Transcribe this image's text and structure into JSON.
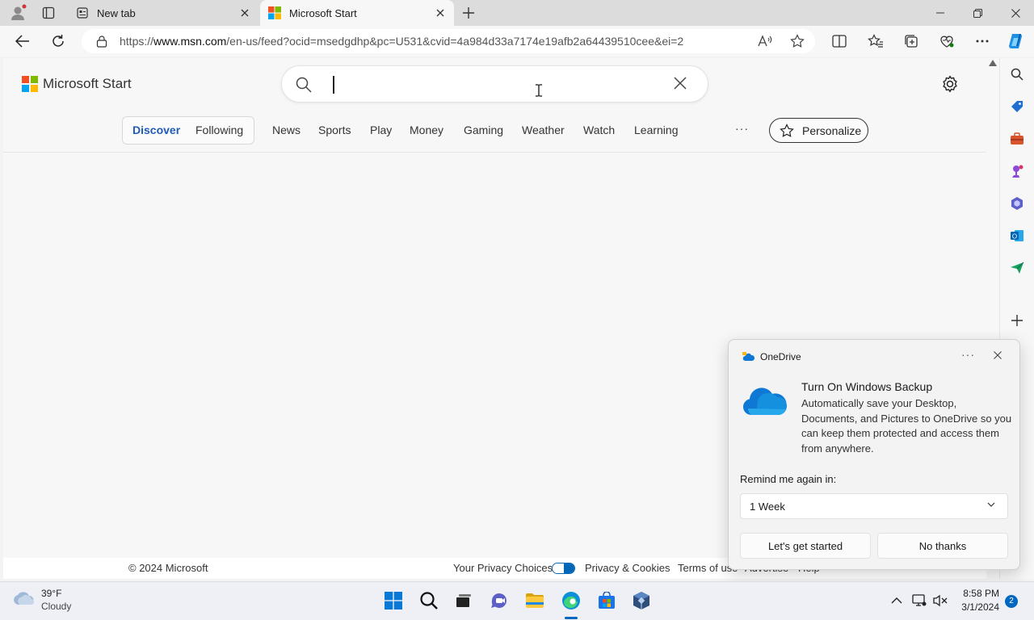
{
  "browser": {
    "tabs": [
      {
        "label": "New tab"
      },
      {
        "label": "Microsoft Start"
      }
    ],
    "url_prefix": "https://",
    "url_domain": "www.msn.com",
    "url_rest": "/en-us/feed?ocid=msedgdhp&pc=U531&cvid=4a984d33a7174e19afb2a64439510cee&ei=2"
  },
  "page": {
    "brand": "Microsoft Start",
    "search_placeholder": "",
    "feed_tabs": [
      "Discover",
      "Following"
    ],
    "categories": [
      "News",
      "Sports",
      "Play",
      "Money",
      "Gaming",
      "Weather",
      "Watch",
      "Learning"
    ],
    "more": "···",
    "personalize": "Personalize"
  },
  "footer": {
    "copyright": "© 2024 Microsoft",
    "privacy_choices": "Your Privacy Choices",
    "privacy_cookies": "Privacy & Cookies",
    "terms": "Terms of use",
    "advertise": "Advertise",
    "help": "Help"
  },
  "toast": {
    "app": "OneDrive",
    "more": "···",
    "title": "Turn On Windows Backup",
    "body": "Automatically save your Desktop, Documents, and Pictures to OneDrive so you can keep them protected and access them from anywhere.",
    "remind_label": "Remind me again in:",
    "remind_value": "1 Week",
    "primary_button": "Let's get started",
    "secondary_button": "No thanks"
  },
  "taskbar": {
    "weather_temp": "39°F",
    "weather_cond": "Cloudy",
    "time": "8:58 PM",
    "date": "3/1/2024",
    "notification_count": "2"
  },
  "colors": {
    "accent": "#0067c0",
    "discover": "#1f5bb8",
    "ms_red": "#f25022",
    "ms_green": "#7fba00",
    "ms_blue": "#00a4ef",
    "ms_yellow": "#ffb900"
  }
}
